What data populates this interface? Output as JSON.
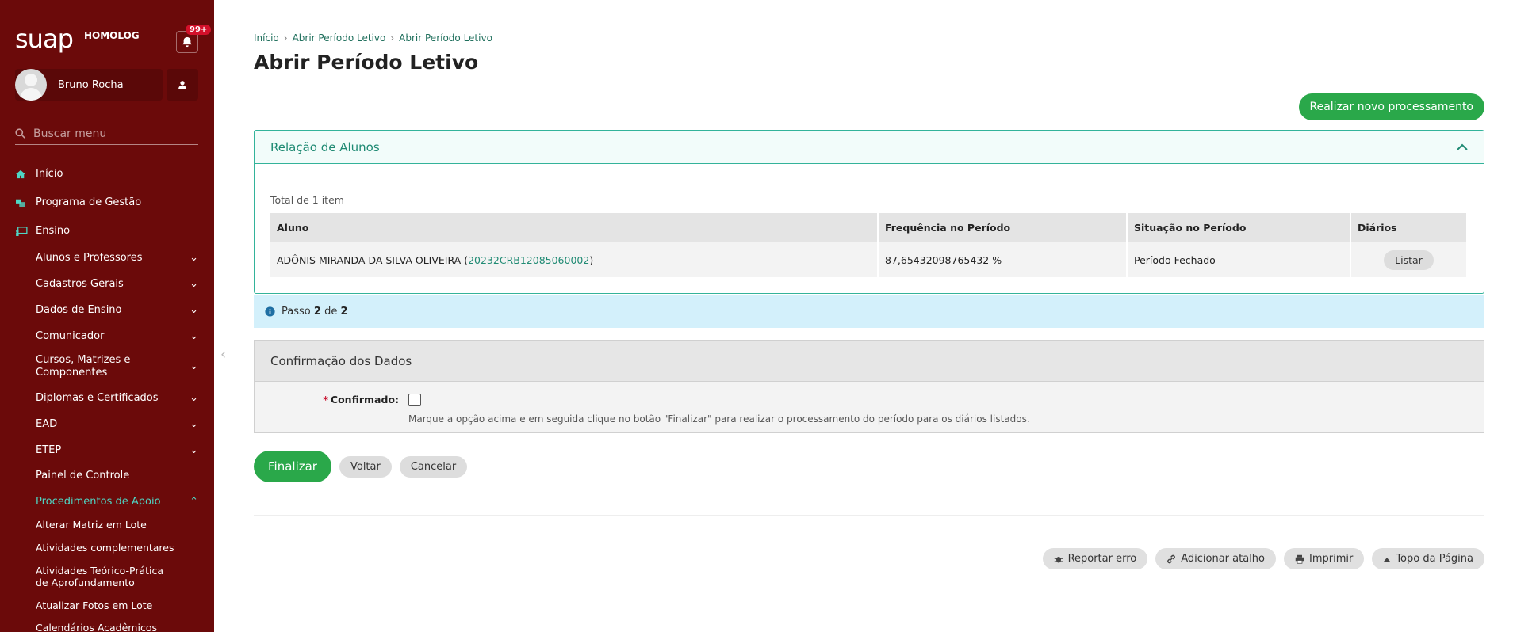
{
  "app": {
    "logo": "suap",
    "env": "HOMOLOG",
    "notification_count": "99+",
    "user_name": "Bruno Rocha",
    "search_placeholder": "Buscar menu"
  },
  "menu": {
    "top": [
      {
        "label": "Início",
        "icon": "home-icon"
      },
      {
        "label": "Programa de Gestão",
        "icon": "group-icon"
      },
      {
        "label": "Ensino",
        "icon": "teacher-icon"
      }
    ],
    "ensino": [
      "Alunos e Professores",
      "Cadastros Gerais",
      "Dados de Ensino",
      "Comunicador",
      "Cursos, Matrizes e Componentes",
      "Diplomas e Certificados",
      "EAD",
      "ETEP",
      "Painel de Controle",
      "Procedimentos de Apoio"
    ],
    "apoio": [
      "Alterar Matriz em Lote",
      "Atividades complementares",
      "Atividades Teórico-Prática de Aprofundamento",
      "Atualizar Fotos em Lote",
      "Calendários Acadêmicos"
    ]
  },
  "breadcrumb": [
    "Início",
    "Abrir Período Letivo",
    "Abrir Período Letivo"
  ],
  "page_title": "Abrir Período Letivo",
  "new_process_button": "Realizar novo processamento",
  "students_box": {
    "title": "Relação de Alunos",
    "total": "Total de 1 item",
    "headers": [
      "Aluno",
      "Frequência no Período",
      "Situação no Período",
      "Diários"
    ],
    "rows": [
      {
        "aluno_name": "ADÔNIS MIRANDA DA SILVA OLIVEIRA",
        "aluno_code": "20232CRB12085060002",
        "frequencia": "87,65432098765432 %",
        "situacao": "Período Fechado",
        "action": "Listar"
      }
    ]
  },
  "step": {
    "prefix": "Passo",
    "current": "2",
    "middle": "de",
    "total": "2"
  },
  "confirm": {
    "title": "Confirmação dos Dados",
    "label": "Confirmado:",
    "help": "Marque a opção acima e em seguida clique no botão \"Finalizar\" para realizar o processamento do período para os diários listados."
  },
  "actions": {
    "finalize": "Finalizar",
    "back": "Voltar",
    "cancel": "Cancelar"
  },
  "footer": {
    "report": "Reportar erro",
    "shortcut": "Adicionar atalho",
    "print": "Imprimir",
    "top": "Topo da Página"
  },
  "colors": {
    "sidebar": "#6b0a0a",
    "accent": "#2aa84a",
    "teal": "#1f8a73"
  }
}
